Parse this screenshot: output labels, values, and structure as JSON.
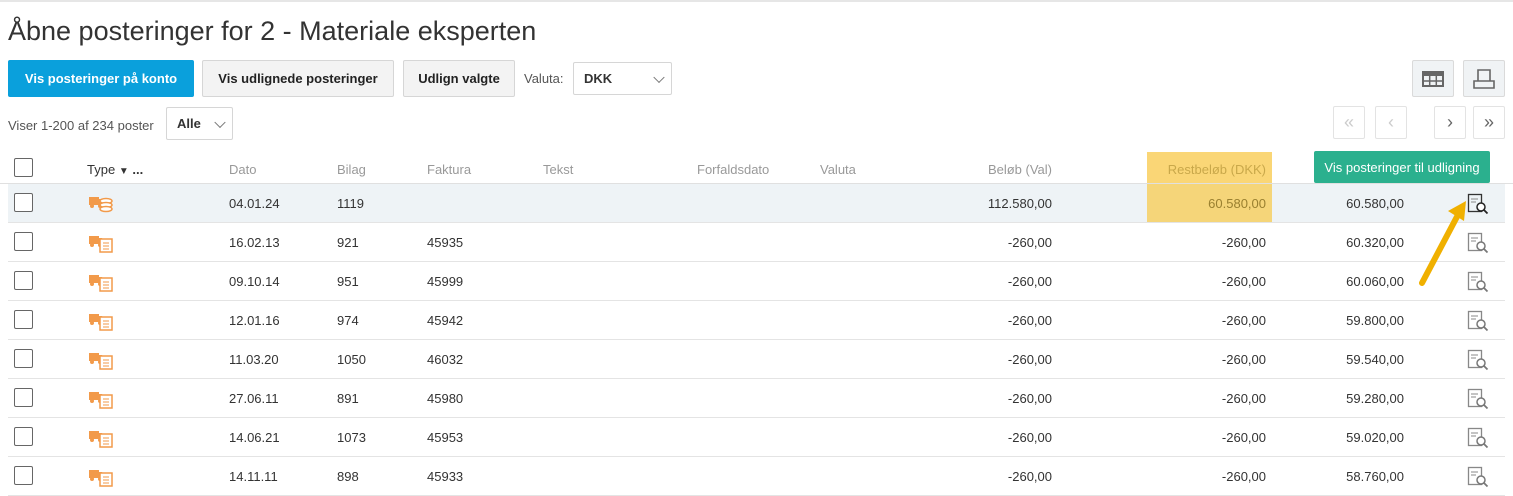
{
  "title": "Åbne posteringer for 2 - Materiale eksperten",
  "toolbar": {
    "show_on_account": "Vis posteringer på konto",
    "show_settled": "Vis udlignede posteringer",
    "settle_selected": "Udlign valgte",
    "currency_label": "Valuta:",
    "currency_value": "DKK",
    "accent": "#0aa0dc"
  },
  "paging": {
    "info": "Viser 1-200 af 234 poster",
    "filter": "Alle"
  },
  "tooltip": "Vis posteringer til udligning",
  "columns": {
    "type": "Type",
    "type_more": "...",
    "dato": "Dato",
    "bilag": "Bilag",
    "faktura": "Faktura",
    "tekst": "Tekst",
    "forfald": "Forfaldsdato",
    "valuta": "Valuta",
    "belob": "Beløb (Val)",
    "rest": "Restbeløb (DKK)"
  },
  "highlight_color": "#fad676",
  "rows": [
    {
      "icon": "truck-coins-icon",
      "dato": "04.01.24",
      "bilag": "1119",
      "faktura": "",
      "belob": "112.580,00",
      "rest": "60.580,00",
      "saldo": "60.580,00",
      "selected": true
    },
    {
      "icon": "truck-invoice-icon",
      "dato": "16.02.13",
      "bilag": "921",
      "faktura": "45935",
      "belob": "-260,00",
      "rest": "-260,00",
      "saldo": "60.320,00"
    },
    {
      "icon": "truck-invoice-icon",
      "dato": "09.10.14",
      "bilag": "951",
      "faktura": "45999",
      "belob": "-260,00",
      "rest": "-260,00",
      "saldo": "60.060,00"
    },
    {
      "icon": "truck-invoice-icon",
      "dato": "12.01.16",
      "bilag": "974",
      "faktura": "45942",
      "belob": "-260,00",
      "rest": "-260,00",
      "saldo": "59.800,00"
    },
    {
      "icon": "truck-invoice-icon",
      "dato": "11.03.20",
      "bilag": "1050",
      "faktura": "46032",
      "belob": "-260,00",
      "rest": "-260,00",
      "saldo": "59.540,00"
    },
    {
      "icon": "truck-invoice-icon",
      "dato": "27.06.11",
      "bilag": "891",
      "faktura": "45980",
      "belob": "-260,00",
      "rest": "-260,00",
      "saldo": "59.280,00"
    },
    {
      "icon": "truck-invoice-icon",
      "dato": "14.06.21",
      "bilag": "1073",
      "faktura": "45953",
      "belob": "-260,00",
      "rest": "-260,00",
      "saldo": "59.020,00"
    },
    {
      "icon": "truck-invoice-icon",
      "dato": "14.11.11",
      "bilag": "898",
      "faktura": "45933",
      "belob": "-260,00",
      "rest": "-260,00",
      "saldo": "58.760,00"
    }
  ]
}
